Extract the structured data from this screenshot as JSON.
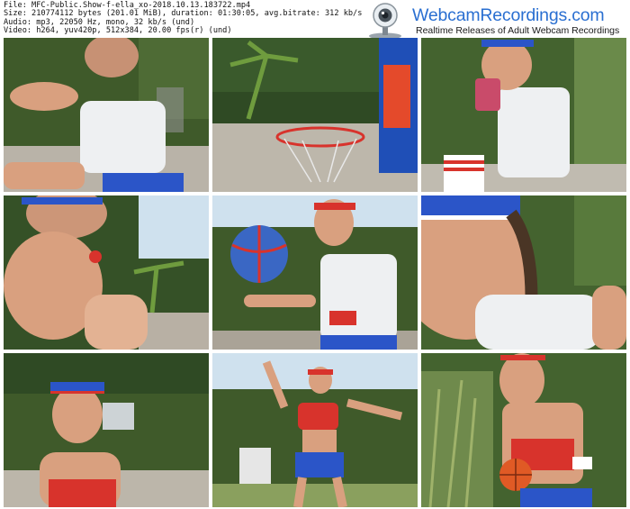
{
  "file_info": {
    "line1": "File: MFC-Public.Show-f-ella_xo-2018.10.13.183722.mp4",
    "line2": "Size: 210774112 bytes (201.01 MiB), duration: 01:30:05, avg.bitrate: 312 kb/s",
    "line3": "Audio: mp3, 22050 Hz, mono, 32 kb/s (und)",
    "line4": "Video: h264, yuv420p, 512x384, 20.00 fps(r) (und)"
  },
  "brand": {
    "name": "WebcamRecordings.com",
    "tagline": "Realtime Releases of Adult Webcam Recordings"
  },
  "thumbnails": [
    {
      "scene": "woman in white tank top seated outdoors, arm raised"
    },
    {
      "scene": "basketball hoop lying on pavement near banana plant"
    },
    {
      "scene": "woman in headband holding a card"
    },
    {
      "scene": "close-up of hand, woman in headband"
    },
    {
      "scene": "woman spinning basketball on finger"
    },
    {
      "scene": "close-up of woman's face wearing headband"
    },
    {
      "scene": "woman in red top with headband, yard behind"
    },
    {
      "scene": "woman in red top and blue shorts stretching"
    },
    {
      "scene": "woman holding basketball, tall grass behind"
    }
  ],
  "colors": {
    "brand_blue": "#2a6fd1",
    "foliage": "#3f5a2a",
    "sky": "#cfe1ee",
    "pavement": "#b9b3a8",
    "skin": "#d9a07f",
    "red": "#d8332c",
    "blue": "#2b55c8"
  }
}
